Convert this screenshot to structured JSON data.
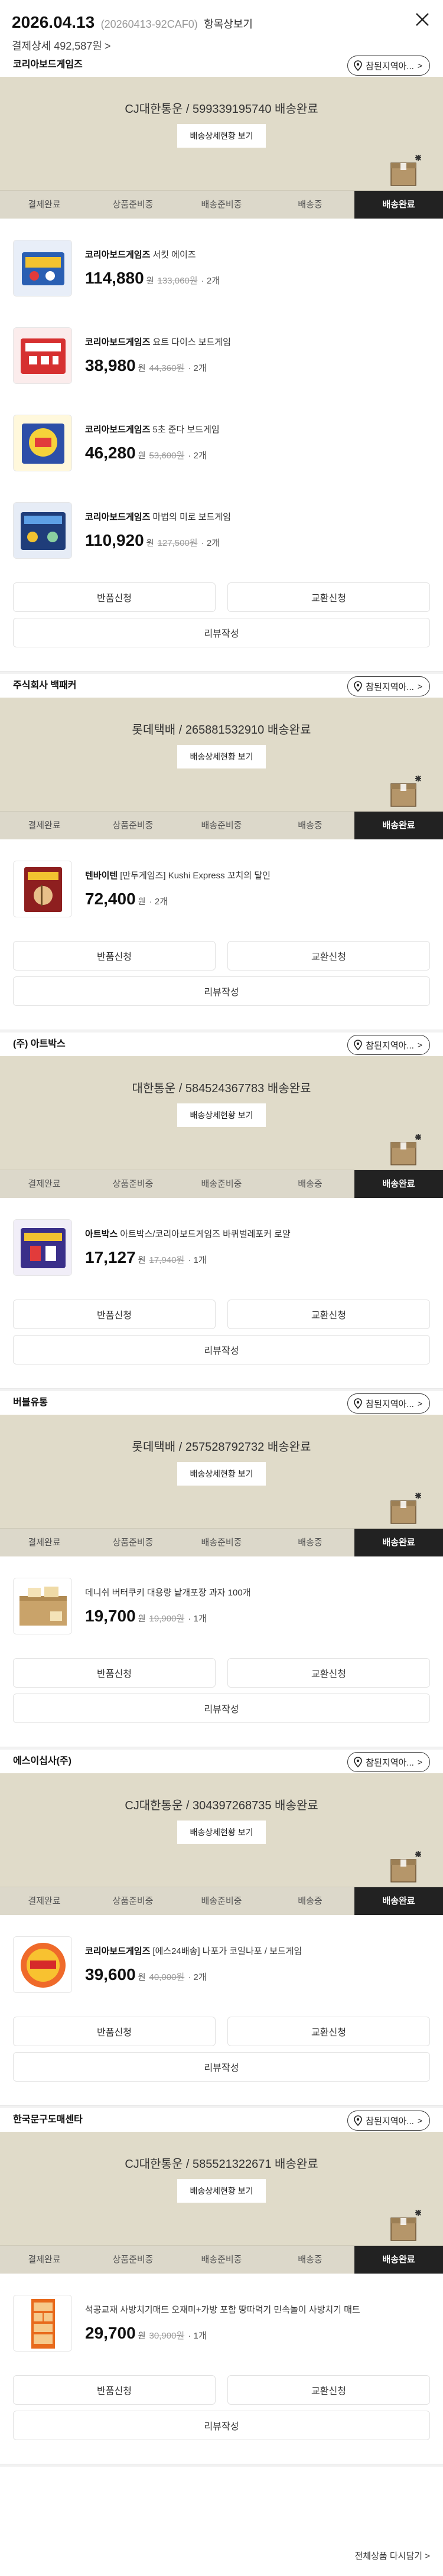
{
  "header": {
    "date": "2026.04.13",
    "order_no": "(20260413-92CAF0)",
    "detail_link": "항목상보기",
    "payment": "결제상세 492,587원",
    "payment_chev": ">"
  },
  "store_button_label": "참된지역아...",
  "store_button_chev": ">",
  "track_button_label": "배송상세현황 보기",
  "steps": [
    "결제완료",
    "상품준비중",
    "배송준비중",
    "배송중",
    "배송완료"
  ],
  "active_step": 4,
  "action_labels": {
    "return": "반품신청",
    "exchange": "교환신청",
    "review": "리뷰작성"
  },
  "currency_unit": "원",
  "shops": [
    {
      "name": "코리아보드게임즈",
      "tracking": "CJ대한통운 / 599339195740 배송완료",
      "items": [
        {
          "brand": "코리아보드게임즈",
          "title": "서킷 에이즈",
          "price": "114,880",
          "orig": "133,060원",
          "qty": "· 2개",
          "thumb": "blue"
        },
        {
          "brand": "코리아보드게임즈",
          "title": "요트 다이스 보드게임",
          "price": "38,980",
          "orig": "44,360원",
          "qty": "· 2개",
          "thumb": "red"
        },
        {
          "brand": "코리아보드게임즈",
          "title": "5초 준다 보드게임",
          "price": "46,280",
          "orig": "53,600원",
          "qty": "· 2개",
          "thumb": "yellow"
        },
        {
          "brand": "코리아보드게임즈",
          "title": "마법의 미로 보드게임",
          "price": "110,920",
          "orig": "127,500원",
          "qty": "· 2개",
          "thumb": "navy"
        }
      ]
    },
    {
      "name": "주식회사 백패커",
      "tracking": "롯데택배 / 265881532910 배송완료",
      "items": [
        {
          "brand": "텐바이텐",
          "title": "[만두게임즈] Kushi Express 꼬치의 달인",
          "price": "72,400",
          "orig": "",
          "qty": "· 2개",
          "thumb": "maroon"
        }
      ]
    },
    {
      "name": "(주) 아트박스",
      "tracking": "대한통운 / 584524367783 배송완료",
      "items": [
        {
          "brand": "아트박스",
          "title": "아트박스/코리아보드게임즈 바퀴벌레포커 로얄",
          "price": "17,127",
          "orig": "17,940원",
          "qty": "· 1개",
          "thumb": "purple"
        }
      ]
    },
    {
      "name": "버블유통",
      "tracking": "롯데택배 / 257528792732 배송완료",
      "items": [
        {
          "brand": "",
          "title": "데니쉬 버터쿠키 대용량 낱개포장 과자 100개",
          "price": "19,700",
          "orig": "19,900원",
          "qty": "· 1개",
          "thumb": "cookie"
        }
      ]
    },
    {
      "name": "에스이십사(주)",
      "tracking": "CJ대한통운 / 304397268735 배송완료",
      "items": [
        {
          "brand": "코리아보드게임즈",
          "title": "[에스24배송] 나포가 코일나포 / 보드게임",
          "price": "39,600",
          "orig": "40,000원",
          "qty": "· 2개",
          "thumb": "orange"
        }
      ]
    },
    {
      "name": "한국문구도매센타",
      "tracking": "CJ대한통운 / 585521322671 배송완료",
      "items": [
        {
          "brand": "",
          "title": "석공교재 사방치기매트 오재미+가방 포함 땅따먹기 민속놀이 사방치기 매트",
          "price": "29,700",
          "orig": "30,900원",
          "qty": "· 1개",
          "thumb": "mat"
        }
      ]
    }
  ],
  "footer_link": "전체상품 다시담기 >"
}
